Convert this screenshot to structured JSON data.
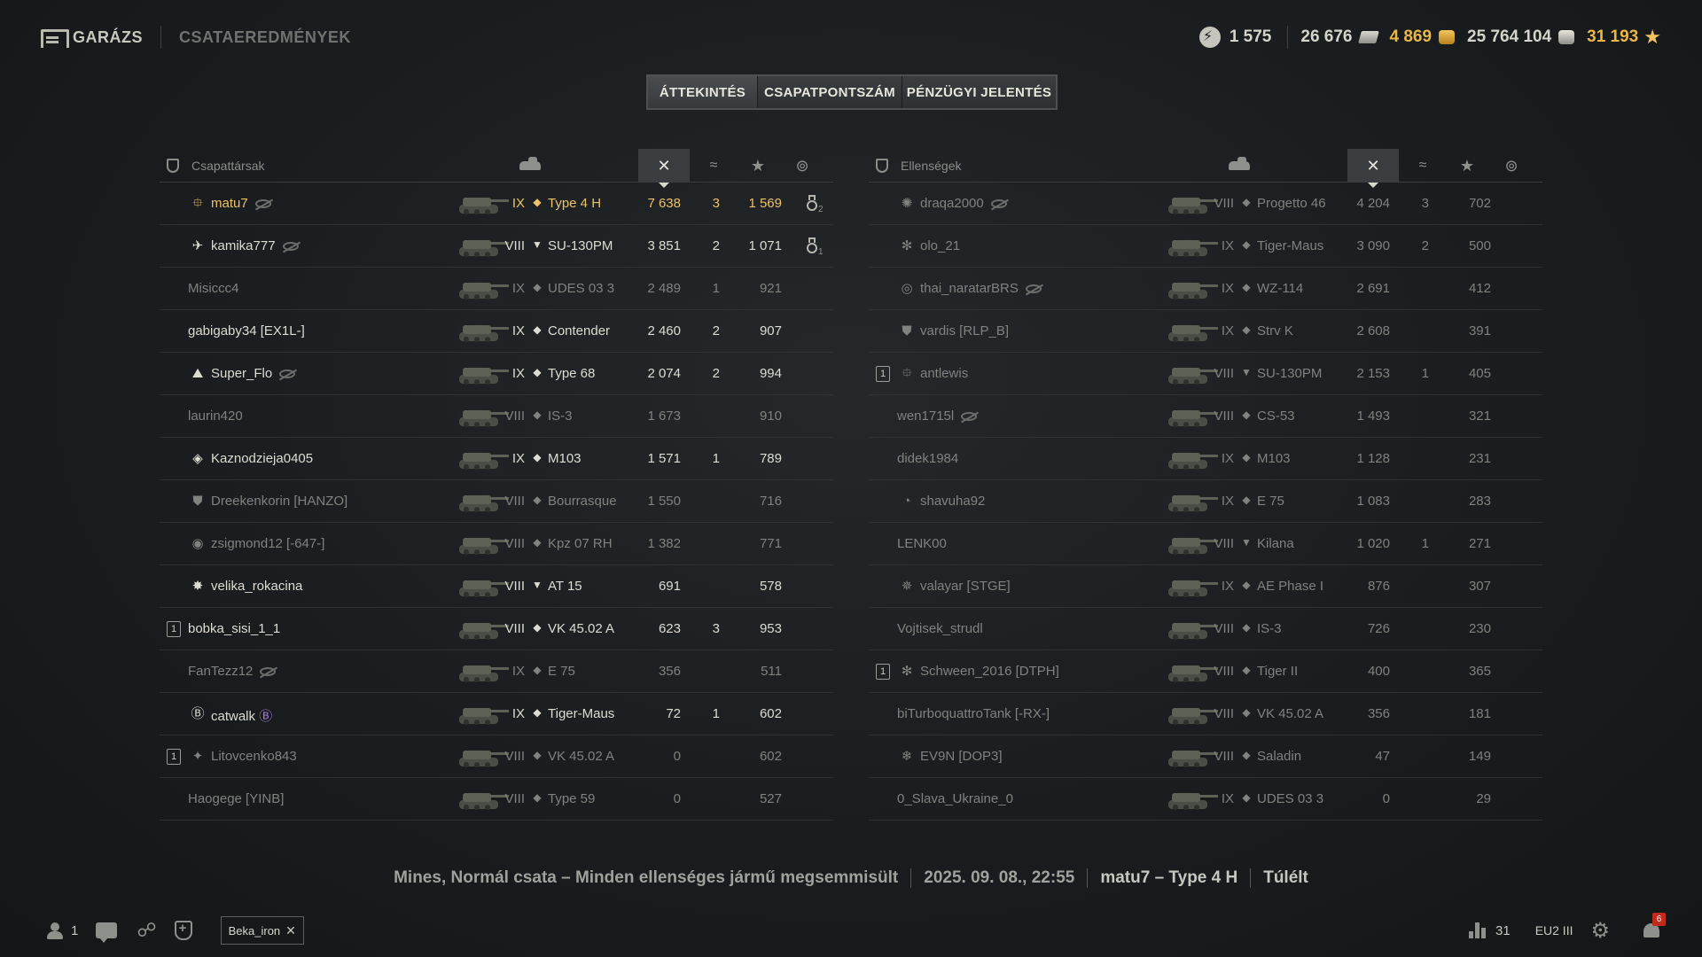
{
  "nav": {
    "garage": "GARÁZS",
    "results": "CSATAEREDMÉNYEK"
  },
  "currencies": {
    "free_xp": "1 575",
    "bonds": "26 676",
    "gold": "4 869",
    "credits": "25 764 104",
    "xp": "31 193"
  },
  "tabs": [
    {
      "label": "ÁTTEKINTÉS",
      "active": true
    },
    {
      "label": "CSAPATPONTSZÁM",
      "active": false
    },
    {
      "label": "PÉNZÜGYI JELENTÉS",
      "active": false
    }
  ],
  "colors": {
    "player": "#ecc26a",
    "alive": "#dcdcd3",
    "dead": "#7f827e",
    "notification": "#c02b1e"
  },
  "allies": {
    "title": "Csapattársak",
    "rows": [
      {
        "platoon": "",
        "badge": "⯐",
        "name": "matu7",
        "hidden": true,
        "tier": "IX",
        "cls": "◆",
        "tank": "Type 4 H",
        "damage": "7 638",
        "kills": "3",
        "xp": "1 569",
        "medals": "2",
        "status": "me"
      },
      {
        "platoon": "",
        "badge": "✈",
        "name": "kamika777",
        "hidden": true,
        "tier": "VIII",
        "cls": "▼",
        "tank": "SU-130PM",
        "damage": "3 851",
        "kills": "2",
        "xp": "1 071",
        "medals": "1",
        "status": "alive"
      },
      {
        "platoon": "",
        "badge": "",
        "name": "Misiccc4",
        "hidden": false,
        "tier": "IX",
        "cls": "◆",
        "tank": "UDES 03 3",
        "damage": "2 489",
        "kills": "1",
        "xp": "921",
        "medals": "",
        "status": "dead"
      },
      {
        "platoon": "",
        "badge": "",
        "name": "gabigaby34 [EX1L-]",
        "hidden": false,
        "tier": "IX",
        "cls": "◆",
        "tank": "Contender",
        "damage": "2 460",
        "kills": "2",
        "xp": "907",
        "medals": "",
        "status": "alive"
      },
      {
        "platoon": "",
        "badge": "⛰",
        "name": "Super_Flo",
        "hidden": true,
        "tier": "IX",
        "cls": "◆",
        "tank": "Type 68",
        "damage": "2 074",
        "kills": "2",
        "xp": "994",
        "medals": "",
        "status": "alive"
      },
      {
        "platoon": "",
        "badge": "",
        "name": "laurin420",
        "hidden": false,
        "tier": "VIII",
        "cls": "◆",
        "tank": "IS-3",
        "damage": "1 673",
        "kills": "",
        "xp": "910",
        "medals": "",
        "status": "dead"
      },
      {
        "platoon": "",
        "badge": "◈",
        "name": "Kaznodzieja0405",
        "hidden": false,
        "tier": "IX",
        "cls": "◆",
        "tank": "M103",
        "damage": "1 571",
        "kills": "1",
        "xp": "789",
        "medals": "",
        "status": "alive"
      },
      {
        "platoon": "",
        "badge": "⛊",
        "name": "Dreekenkorin [HANZO]",
        "hidden": false,
        "tier": "VIII",
        "cls": "◆",
        "tank": "Bourrasque",
        "damage": "1 550",
        "kills": "",
        "xp": "716",
        "medals": "",
        "status": "dead"
      },
      {
        "platoon": "",
        "badge": "◉",
        "name": "zsigmond12 [-647-]",
        "hidden": false,
        "tier": "VIII",
        "cls": "◆",
        "tank": "Kpz 07 RH",
        "damage": "1 382",
        "kills": "",
        "xp": "771",
        "medals": "",
        "status": "dead"
      },
      {
        "platoon": "",
        "badge": "✸",
        "name": "velika_rokacina",
        "hidden": false,
        "tier": "VIII",
        "cls": "▼",
        "tank": "AT 15",
        "damage": "691",
        "kills": "",
        "xp": "578",
        "medals": "",
        "status": "alive"
      },
      {
        "platoon": "1",
        "badge": "",
        "name": "bobka_sisi_1_1",
        "hidden": false,
        "tier": "VIII",
        "cls": "◆",
        "tank": "VK 45.02 A",
        "damage": "623",
        "kills": "3",
        "xp": "953",
        "medals": "",
        "status": "alive"
      },
      {
        "platoon": "",
        "badge": "",
        "name": "FanTezz12",
        "hidden": true,
        "tier": "IX",
        "cls": "◆",
        "tank": "E 75",
        "damage": "356",
        "kills": "",
        "xp": "511",
        "medals": "",
        "status": "dead"
      },
      {
        "platoon": "",
        "badge": "Ⓑ",
        "name": "catwalk",
        "hidden": false,
        "tier": "IX",
        "cls": "◆",
        "tank": "Tiger-Maus",
        "damage": "72",
        "kills": "1",
        "xp": "602",
        "medals": "",
        "status": "alive",
        "extra_badge": "Ⓑ"
      },
      {
        "platoon": "1",
        "badge": "✦",
        "name": "Litovcenko843",
        "hidden": false,
        "tier": "VIII",
        "cls": "◆",
        "tank": "VK 45.02 A",
        "damage": "0",
        "kills": "",
        "xp": "602",
        "medals": "",
        "status": "dead"
      },
      {
        "platoon": "",
        "badge": "",
        "name": "Haogege [YINB]",
        "hidden": false,
        "tier": "VIII",
        "cls": "◆",
        "tank": "Type 59",
        "damage": "0",
        "kills": "",
        "xp": "527",
        "medals": "",
        "status": "dead"
      }
    ]
  },
  "enemies": {
    "title": "Ellenségek",
    "rows": [
      {
        "platoon": "",
        "badge": "✺",
        "name": "draqa2000",
        "hidden": true,
        "tier": "VIII",
        "cls": "◆",
        "tank": "Progetto 46",
        "damage": "4 204",
        "kills": "3",
        "xp": "702",
        "status": "dead"
      },
      {
        "platoon": "",
        "badge": "✻",
        "name": "olo_21",
        "hidden": false,
        "tier": "IX",
        "cls": "◆",
        "tank": "Tiger-Maus",
        "damage": "3 090",
        "kills": "2",
        "xp": "500",
        "status": "dead"
      },
      {
        "platoon": "",
        "badge": "◎",
        "name": "thai_naratarBRS",
        "hidden": true,
        "tier": "IX",
        "cls": "◆",
        "tank": "WZ-114",
        "damage": "2 691",
        "kills": "",
        "xp": "412",
        "status": "dead"
      },
      {
        "platoon": "",
        "badge": "⛊",
        "name": "vardis [RLP_B]",
        "hidden": false,
        "tier": "IX",
        "cls": "◆",
        "tank": "Strv K",
        "damage": "2 608",
        "kills": "",
        "xp": "391",
        "status": "dead"
      },
      {
        "platoon": "1",
        "badge": "⯐",
        "name": "antlewis",
        "hidden": false,
        "tier": "VIII",
        "cls": "▼",
        "tank": "SU-130PM",
        "damage": "2 153",
        "kills": "1",
        "xp": "405",
        "status": "dead"
      },
      {
        "platoon": "",
        "badge": "",
        "name": "wen1715l",
        "hidden": true,
        "tier": "VIII",
        "cls": "◆",
        "tank": "CS-53",
        "damage": "1 493",
        "kills": "",
        "xp": "321",
        "status": "dead"
      },
      {
        "platoon": "",
        "badge": "",
        "name": "didek1984",
        "hidden": false,
        "tier": "IX",
        "cls": "◆",
        "tank": "M103",
        "damage": "1 128",
        "kills": "",
        "xp": "231",
        "status": "dead"
      },
      {
        "platoon": "",
        "badge": "◔",
        "name": "shavuha92",
        "hidden": false,
        "tier": "IX",
        "cls": "◆",
        "tank": "E 75",
        "damage": "1 083",
        "kills": "",
        "xp": "283",
        "status": "dead"
      },
      {
        "platoon": "",
        "badge": "",
        "name": "LENK00",
        "hidden": false,
        "tier": "VIII",
        "cls": "▼",
        "tank": "Kilana",
        "damage": "1 020",
        "kills": "1",
        "xp": "271",
        "status": "dead"
      },
      {
        "platoon": "",
        "badge": "✵",
        "name": "valayar [STGE]",
        "hidden": false,
        "tier": "IX",
        "cls": "◆",
        "tank": "AE Phase I",
        "damage": "876",
        "kills": "",
        "xp": "307",
        "status": "dead"
      },
      {
        "platoon": "",
        "badge": "",
        "name": "Vojtisek_strudl",
        "hidden": false,
        "tier": "VIII",
        "cls": "◆",
        "tank": "IS-3",
        "damage": "726",
        "kills": "",
        "xp": "230",
        "status": "dead"
      },
      {
        "platoon": "1",
        "badge": "✻",
        "name": "Schween_2016 [DTPH]",
        "hidden": false,
        "tier": "VIII",
        "cls": "◆",
        "tank": "Tiger II",
        "damage": "400",
        "kills": "",
        "xp": "365",
        "status": "dead"
      },
      {
        "platoon": "",
        "badge": "",
        "name": "biTurboquattroTank [-RX-]",
        "hidden": false,
        "tier": "VIII",
        "cls": "◆",
        "tank": "VK 45.02 A",
        "damage": "356",
        "kills": "",
        "xp": "181",
        "status": "dead"
      },
      {
        "platoon": "",
        "badge": "❄",
        "name": "EV9N [DOP3]",
        "hidden": false,
        "tier": "VIII",
        "cls": "◆",
        "tank": "Saladin",
        "damage": "47",
        "kills": "",
        "xp": "149",
        "status": "dead"
      },
      {
        "platoon": "",
        "badge": "",
        "name": "0_Slava_Ukraine_0",
        "hidden": false,
        "tier": "IX",
        "cls": "◆",
        "tank": "UDES 03 3",
        "damage": "0",
        "kills": "",
        "xp": "29",
        "status": "dead"
      }
    ]
  },
  "battle_info": {
    "map_mode": "Mines, Normál csata – Minden ellenséges jármű megsemmisült",
    "datetime": "2025. 09. 08., 22:55",
    "player_tank": "matu7 – Type 4 H",
    "result": "Túlélt"
  },
  "bottom": {
    "online_count": "1",
    "contact_chip": "Beka_iron",
    "stat_count": "31",
    "server": "EU2 III",
    "notifications": "6"
  }
}
